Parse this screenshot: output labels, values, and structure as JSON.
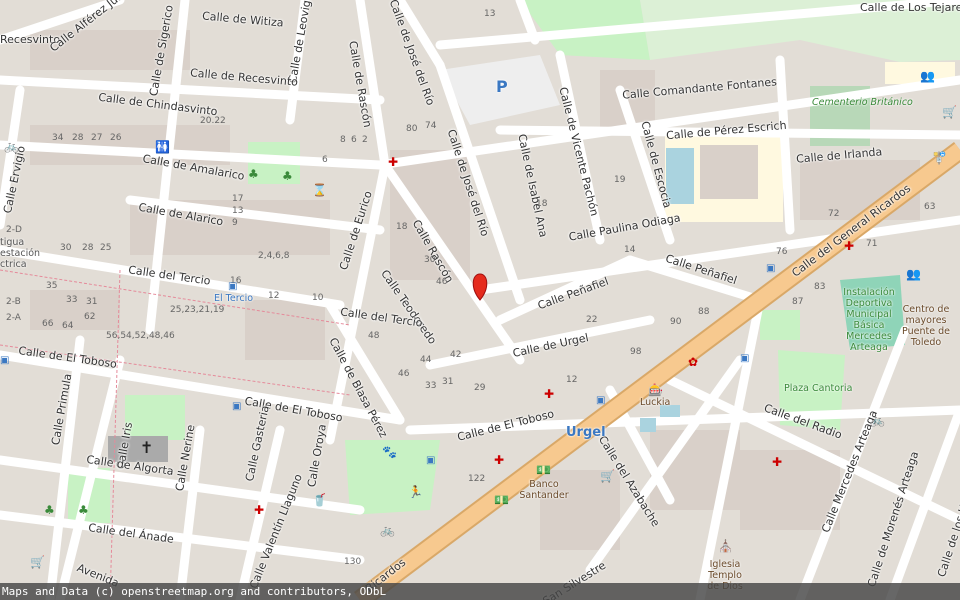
{
  "map": {
    "attribution": "Maps and Data (c) openstreetmap.org and contributors, ODbL",
    "marker_icon": "map-pin-icon",
    "colors": {
      "background": "#e2ddd6",
      "road": "#ffffff",
      "major_road": "#f7c98f",
      "park": "#c8f2c4",
      "block": "#d9d0c9",
      "water": "#aad3df",
      "parking": "#eeeeee",
      "pin": "#e52b1d"
    }
  },
  "streets": {
    "recesvinto_w": "Recesvinto",
    "alferez_juan": "Calle Alférez Juan",
    "witiza": "Calle de Witiza",
    "sigerico": "Calle de Sigerico",
    "leovigildo": "Calle de Leovigildo",
    "jose_del_rio_n": "Calle de José del Río",
    "los_tejares": "Calle de Los Tejares",
    "recesvinto": "Calle de Recesvinto",
    "rascon_n": "Calle de Rascón",
    "chindasvinto": "Calle de Chindasvinto",
    "comandante_fontanes": "Calle Comandante Fontanes",
    "vicente_pachon": "Calle de Vicente Pachón",
    "jose_del_rio": "Calle de José del Río",
    "isabel_ana": "Calle de Isabel Ana",
    "escocia": "Calle de Escocia",
    "perez_escrich": "Calle de Pérez Escrich",
    "irlanda": "Calle de Irlanda",
    "amalarico": "Calle de Amalarico",
    "erugio": "Calle Ervigio",
    "alarico": "Calle de Alarico",
    "eurico": "Calle de Eurico",
    "rascon": "Calle Rascón",
    "paulina_odiaga": "Calle Paulina Odiaga",
    "general_ricardos": "Calle del General Ricardos",
    "tercio": "Calle del Tercio",
    "teodoredo": "Calle Teodoredo",
    "penafiel_e": "Calle Peñafiel",
    "penafiel": "Calle Peñafiel",
    "tercio_2": "Calle del Tercio",
    "urgel": "Calle de Urgel",
    "blasa_perez": "Calle de Blasa Pérez",
    "el_toboso_w": "Calle de El Toboso",
    "el_toboso": "Calle de El Toboso",
    "el_toboso_e": "Calle de El Toboso",
    "primula": "Calle Primula",
    "iris": "Calle Iris",
    "gasteria": "Calle Gasteria",
    "oroya": "Calle Oroya",
    "nerine": "Calle Nerine",
    "algorta": "Calle de Algorta",
    "anade": "Calle del Ánade",
    "valentin_llaguno": "Calle Valentín Llaguno",
    "avenida": "Avenida",
    "general_ricardos_s": "Ricardos",
    "azabache": "Calle del Azabache",
    "radio": "Calle del Radio",
    "mercedes_arteaga": "Calle Mercedes Arteaga",
    "morenes_arteaga": "Calle de Morenés Arteaga",
    "hermanos": "Calle de los Hermanos de",
    "san_silvestre": "Calle San Silvestre"
  },
  "places": {
    "cementerio": "Cementerio Británico",
    "instalacion": "Instalación Deportiva Municipal Básica Mercedes Arteaga",
    "centro_mayores": "Centro de mayores Puente de Toledo",
    "plaza_cantoria": "Plaza Cantoria",
    "el_tercio": "El Tercio",
    "urgel": "Urgel",
    "lucia": "Luckia",
    "banco": "Banco Santander",
    "iglesia": "Iglesia Templo de Dios",
    "antigua": "tigua estación ctrica",
    "parking_p": "P"
  },
  "numbers": [
    "34",
    "28",
    "27",
    "26",
    "20.22",
    "80",
    "74",
    "8",
    "6",
    "2",
    "17",
    "13",
    "9",
    "30",
    "28",
    "25",
    "16",
    "12",
    "10",
    "18",
    "46",
    "30",
    "35",
    "33",
    "31",
    "66",
    "64",
    "62",
    "56,54,52,48,46",
    "25,23,21,19",
    "48",
    "46",
    "44",
    "42",
    "33",
    "31",
    "29",
    "22",
    "14",
    "19",
    "90",
    "98",
    "88",
    "72",
    "71",
    "63",
    "76",
    "87",
    "83",
    "12",
    "122",
    "130",
    "2,4,6,8",
    "13",
    "6",
    "2-D",
    "2-B",
    "2-A",
    "18"
  ]
}
